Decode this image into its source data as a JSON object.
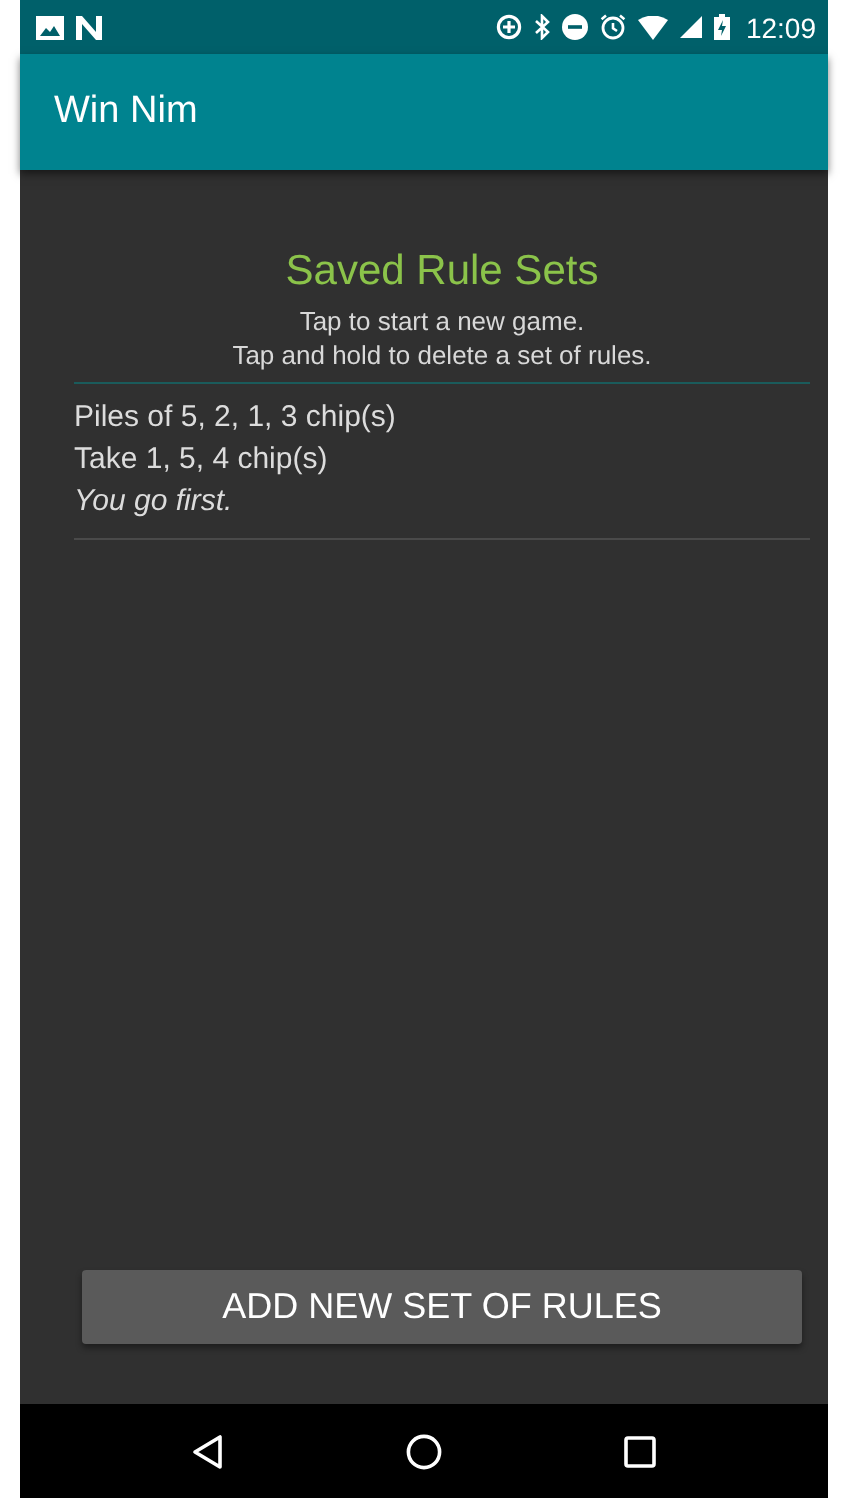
{
  "status_bar": {
    "time": "12:09"
  },
  "app_bar": {
    "title": "Win Nim"
  },
  "header": {
    "title": "Saved Rule Sets",
    "hints": [
      "Tap to start a new game.",
      "Tap and hold to delete a set of rules."
    ]
  },
  "rule_sets": [
    {
      "piles": "Piles of 5, 2, 1, 3 chip(s)",
      "take": "Take 1, 5, 4 chip(s)",
      "turn": "You go first."
    }
  ],
  "add_button": {
    "label": "ADD NEW SET OF RULES"
  }
}
